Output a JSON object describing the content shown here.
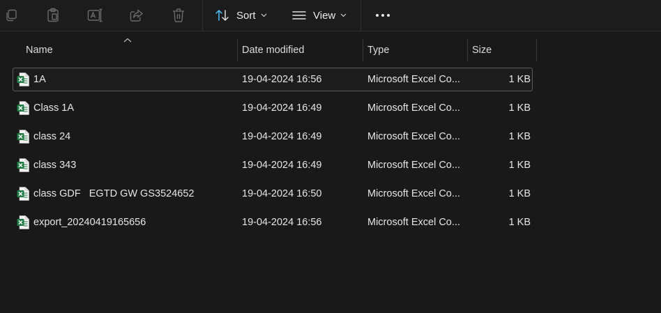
{
  "toolbar": {
    "icons": [
      "copy-icon",
      "paste-icon",
      "rename-icon",
      "share-icon",
      "delete-icon"
    ],
    "sort_label": "Sort",
    "view_label": "View",
    "more_icon": "more-icon"
  },
  "columns": {
    "name": "Name",
    "date": "Date modified",
    "type": "Type",
    "size": "Size"
  },
  "files": [
    {
      "name": "1A",
      "date": "19-04-2024 16:56",
      "type": "Microsoft Excel Co...",
      "size": "1 KB",
      "selected": true
    },
    {
      "name": "Class 1A",
      "date": "19-04-2024 16:49",
      "type": "Microsoft Excel Co...",
      "size": "1 KB"
    },
    {
      "name": "class 24",
      "date": "19-04-2024 16:49",
      "type": "Microsoft Excel Co...",
      "size": "1 KB"
    },
    {
      "name": "class 343",
      "date": "19-04-2024 16:49",
      "type": "Microsoft Excel Co...",
      "size": "1 KB"
    },
    {
      "name": "class GDF   EGTD GW GS3524652",
      "date": "19-04-2024 16:50",
      "type": "Microsoft Excel Co...",
      "size": "1 KB"
    },
    {
      "name": "export_20240419165656",
      "date": "19-04-2024 16:56",
      "type": "Microsoft Excel Co...",
      "size": "1 KB"
    }
  ],
  "colors": {
    "excel_green": "#1f7a44",
    "accent_blue": "#4cc2ff"
  }
}
